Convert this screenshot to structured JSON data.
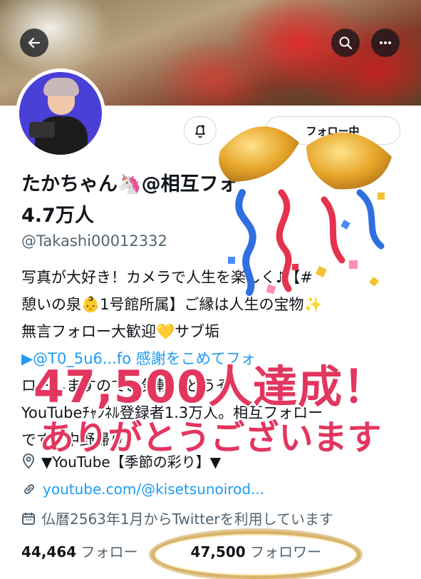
{
  "profile": {
    "display_name": "たかちゃん🦄@相互フォ",
    "follower_count_line": "4.7万人",
    "handle": "@Takashi00012332",
    "bio_lines": [
      "写真が大好き！カメラで人生を楽しく♪【#",
      "憩いの泉👶1号館所属】ご縁は人生の宝物✨",
      "無言フォロー大歓迎💛サブ垢",
      "▶@T0_5u6...fo 感謝をこめてフォ",
      "ローしますのでお気軽にどうぞ。",
      "YouTubeﾁｬﾝﾈﾙ登録者1.3万人。相互フォロー",
      "です。中野帰り"
    ],
    "location": "▼YouTube【季節の彩り】▼",
    "website": "youtube.com/@kisetsunoirod...",
    "joined": "仏暦2563年1月からTwitterを利用しています"
  },
  "stats": {
    "following_count": "44,464",
    "following_label": "フォロー",
    "followers_count": "47,500",
    "followers_label": "フォロワー"
  },
  "actions": {
    "follow_button_label": "フォロー中"
  },
  "celebration": {
    "line1": "47,500人達成！",
    "line2": "ありがとうございます"
  },
  "icons": {
    "back": "arrow-left-icon",
    "search": "search-icon",
    "more": "more-icon",
    "notify": "bell-plus-icon",
    "location": "location-pin-icon",
    "link": "link-icon",
    "calendar": "calendar-icon"
  },
  "colors": {
    "accent_link": "#1d9bf0",
    "overlay_text": "#e2365f",
    "ring_gold": "#d8b46a"
  }
}
